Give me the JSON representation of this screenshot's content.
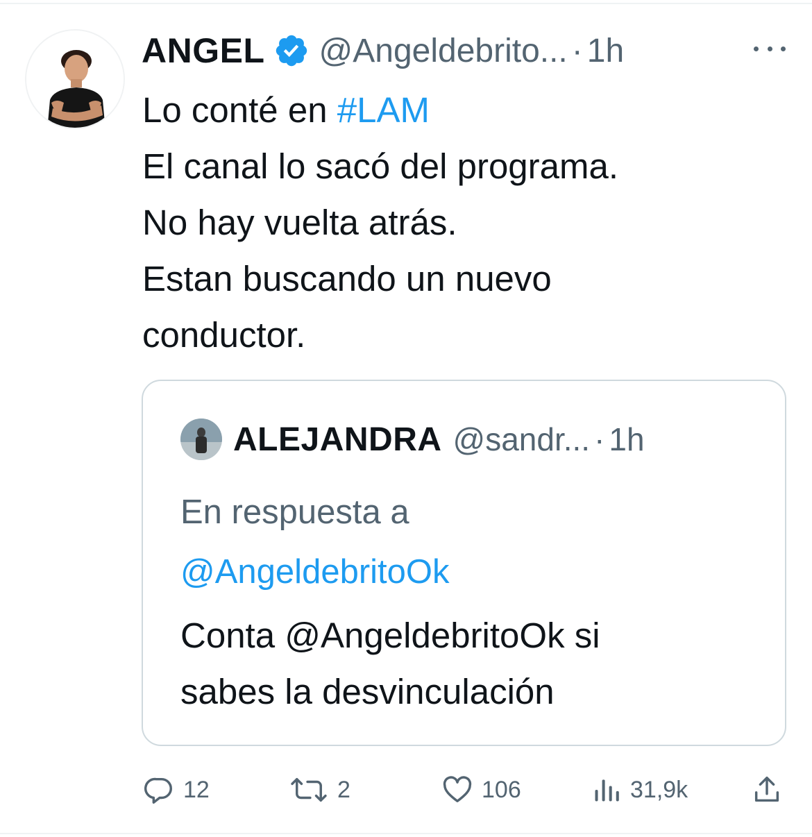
{
  "tweet": {
    "author": {
      "name": "ANGEL",
      "handle": "@Angeldebrito...",
      "separator": "·",
      "time": "1h",
      "avatar_icon": "profile-photo"
    },
    "text_lines": [
      {
        "plain": "Lo conté en ",
        "hashtag": "#LAM"
      },
      {
        "plain": "El canal lo sacó del programa."
      },
      {
        "plain": "No hay vuelta atrás."
      },
      {
        "plain": "Estan buscando un nuevo"
      },
      {
        "plain": "conductor."
      }
    ],
    "quoted": {
      "name": "ALEJANDRA",
      "handle": "@sandr...",
      "separator": "·",
      "time": "1h",
      "reply_prefix": "En respuesta a",
      "reply_mention": "@AngeldebritoOk",
      "text_lines": [
        "Conta @AngeldebritoOk si",
        "sabes la desvinculación"
      ]
    },
    "actions": {
      "replies": "12",
      "retweets": "2",
      "likes": "106",
      "views": "31,9k"
    }
  },
  "colors": {
    "accent": "#1d9bf0",
    "secondary_text": "#536471",
    "primary_text": "#0f1419",
    "border": "#cfd9de"
  }
}
